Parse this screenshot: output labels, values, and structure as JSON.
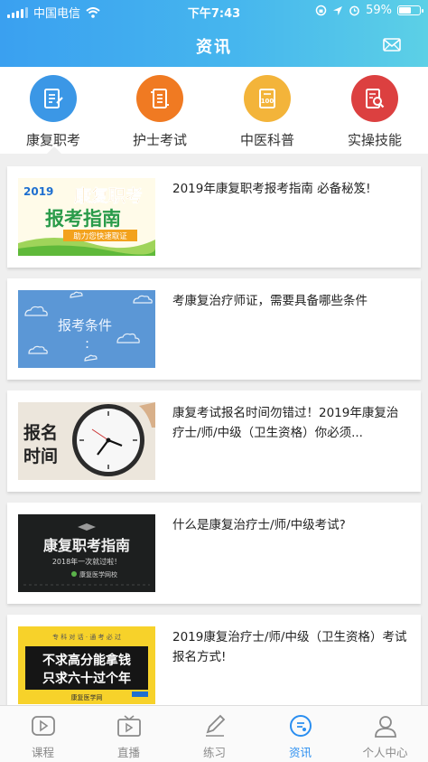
{
  "status_bar": {
    "carrier": "中国电信",
    "time": "下午7:43",
    "battery": "59%"
  },
  "nav": {
    "title": "资讯",
    "right_icon": "mail-icon"
  },
  "categories": [
    {
      "label": "康复职考",
      "icon": "document-edit-icon",
      "color": "#3b97e6"
    },
    {
      "label": "护士考试",
      "icon": "scroll-icon",
      "color": "#f07a22"
    },
    {
      "label": "中医科普",
      "icon": "score-paper-icon",
      "color": "#f3b43a"
    },
    {
      "label": "实操技能",
      "icon": "search-document-icon",
      "color": "#dc4040"
    }
  ],
  "articles": [
    {
      "title": "2019年康复职考报考指南 必备秘笈!",
      "thumb": {
        "year": "2019",
        "line1": "康复职考",
        "line2": "报考指南",
        "ribbon": "助力您快速取证"
      }
    },
    {
      "title": "考康复治疗师证，需要具备哪些条件",
      "thumb": {
        "text": "报考条件",
        "colon": ":"
      }
    },
    {
      "title": "康复考试报名时间勿错过！2019年康复治疗士/师/中级（卫生资格）你必须...",
      "thumb": {
        "line1": "报名",
        "line2": "时间"
      }
    },
    {
      "title": "什么是康复治疗士/师/中级考试?",
      "thumb": {
        "line1": "康复职考指南",
        "line2": "2018年一次就过啦！",
        "brand": "康复医学网校"
      }
    },
    {
      "title": "2019康复治疗士/师/中级（卫生资格）考试报名方式!",
      "thumb": {
        "top": "专 科 对 话 · 通 考 必 过",
        "line1": "不求高分能拿钱",
        "line2": "只求六十过个年",
        "brand": "康复医学网"
      }
    }
  ],
  "tabs": [
    {
      "label": "课程",
      "icon": "play-icon",
      "active": false
    },
    {
      "label": "直播",
      "icon": "tv-icon",
      "active": false
    },
    {
      "label": "练习",
      "icon": "pencil-icon",
      "active": false
    },
    {
      "label": "资讯",
      "icon": "news-icon",
      "active": true
    },
    {
      "label": "个人中心",
      "icon": "person-icon",
      "active": false
    }
  ]
}
